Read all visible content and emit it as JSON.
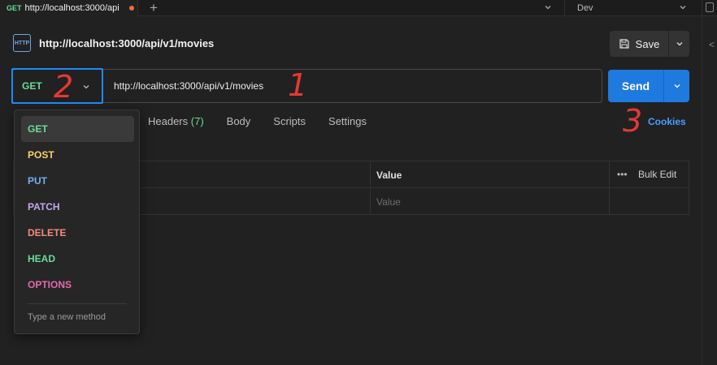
{
  "tab": {
    "method": "GET",
    "url": "http://localhost:3000/api"
  },
  "environment": {
    "name": "Dev"
  },
  "request": {
    "title": "http://localhost:3000/api/v1/movies",
    "method": "GET",
    "url": "http://localhost:3000/api/v1/movies",
    "http_icon": "HTTP"
  },
  "toolbar": {
    "save_label": "Save",
    "send_label": "Send"
  },
  "subtabs": [
    {
      "label": "Headers",
      "count": "(7)"
    },
    {
      "label": "Body"
    },
    {
      "label": "Scripts"
    },
    {
      "label": "Settings"
    }
  ],
  "cookies_label": "Cookies",
  "params_table": {
    "value_header": "Value",
    "bulk_edit": "Bulk Edit",
    "dots": "•••",
    "value_placeholder": "Value"
  },
  "method_dropdown": {
    "items": [
      {
        "label": "GET",
        "color": "#6bdd9a"
      },
      {
        "label": "POST",
        "color": "#f5d36b"
      },
      {
        "label": "PUT",
        "color": "#74aef6"
      },
      {
        "label": "PATCH",
        "color": "#c4a7e7"
      },
      {
        "label": "DELETE",
        "color": "#f28b82"
      },
      {
        "label": "HEAD",
        "color": "#6bdd9a"
      },
      {
        "label": "OPTIONS",
        "color": "#e26bb0"
      }
    ],
    "new_method_label": "Type a new method"
  },
  "annotations": [
    "1",
    "2",
    "3"
  ],
  "colors": {
    "accent": "#1f7ae0",
    "selection_outline": "#1d8cf8",
    "annotation": "#e53935"
  }
}
